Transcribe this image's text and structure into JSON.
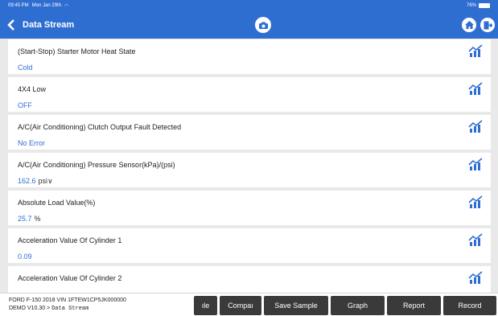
{
  "status": {
    "time": "09:45 PM",
    "date": "Mon Jan 29th",
    "battery": "76%"
  },
  "header": {
    "title": "Data Stream"
  },
  "rows": [
    {
      "name": "(Start-Stop) Starter Motor Heat State",
      "value": "Cold",
      "unit": ""
    },
    {
      "name": "4X4 Low",
      "value": "OFF",
      "unit": ""
    },
    {
      "name": "A/C(Air Conditioning) Clutch Output Fault Detected",
      "value": "No Error",
      "unit": ""
    },
    {
      "name": "A/C(Air Conditioning) Pressure Sensor(kPa)/(psi)",
      "value": "162.6",
      "unit": "psi∨"
    },
    {
      "name": "Absolute Load Value(%)",
      "value": "25.7",
      "unit": "%"
    },
    {
      "name": "Acceleration Value Of Cylinder 1",
      "value": "0.09",
      "unit": ""
    },
    {
      "name": "Acceleration Value Of Cylinder 2",
      "value": "",
      "unit": ""
    }
  ],
  "footer": {
    "vehicle_line1": "FORD  F-150  2018  VIN  1FTEW1CP5JK000000",
    "vehicle_line2_prefix": "DEMO V10.30 > ",
    "vehicle_line2_path": "Data Stream",
    "buttons": {
      "b1": "ıle",
      "b2": "Compaı",
      "save_sample": "Save Sample",
      "graph": "Graph",
      "report": "Report",
      "record": "Record"
    }
  },
  "colors": {
    "accent": "#2f6ed1",
    "button": "#3a3a3a"
  }
}
